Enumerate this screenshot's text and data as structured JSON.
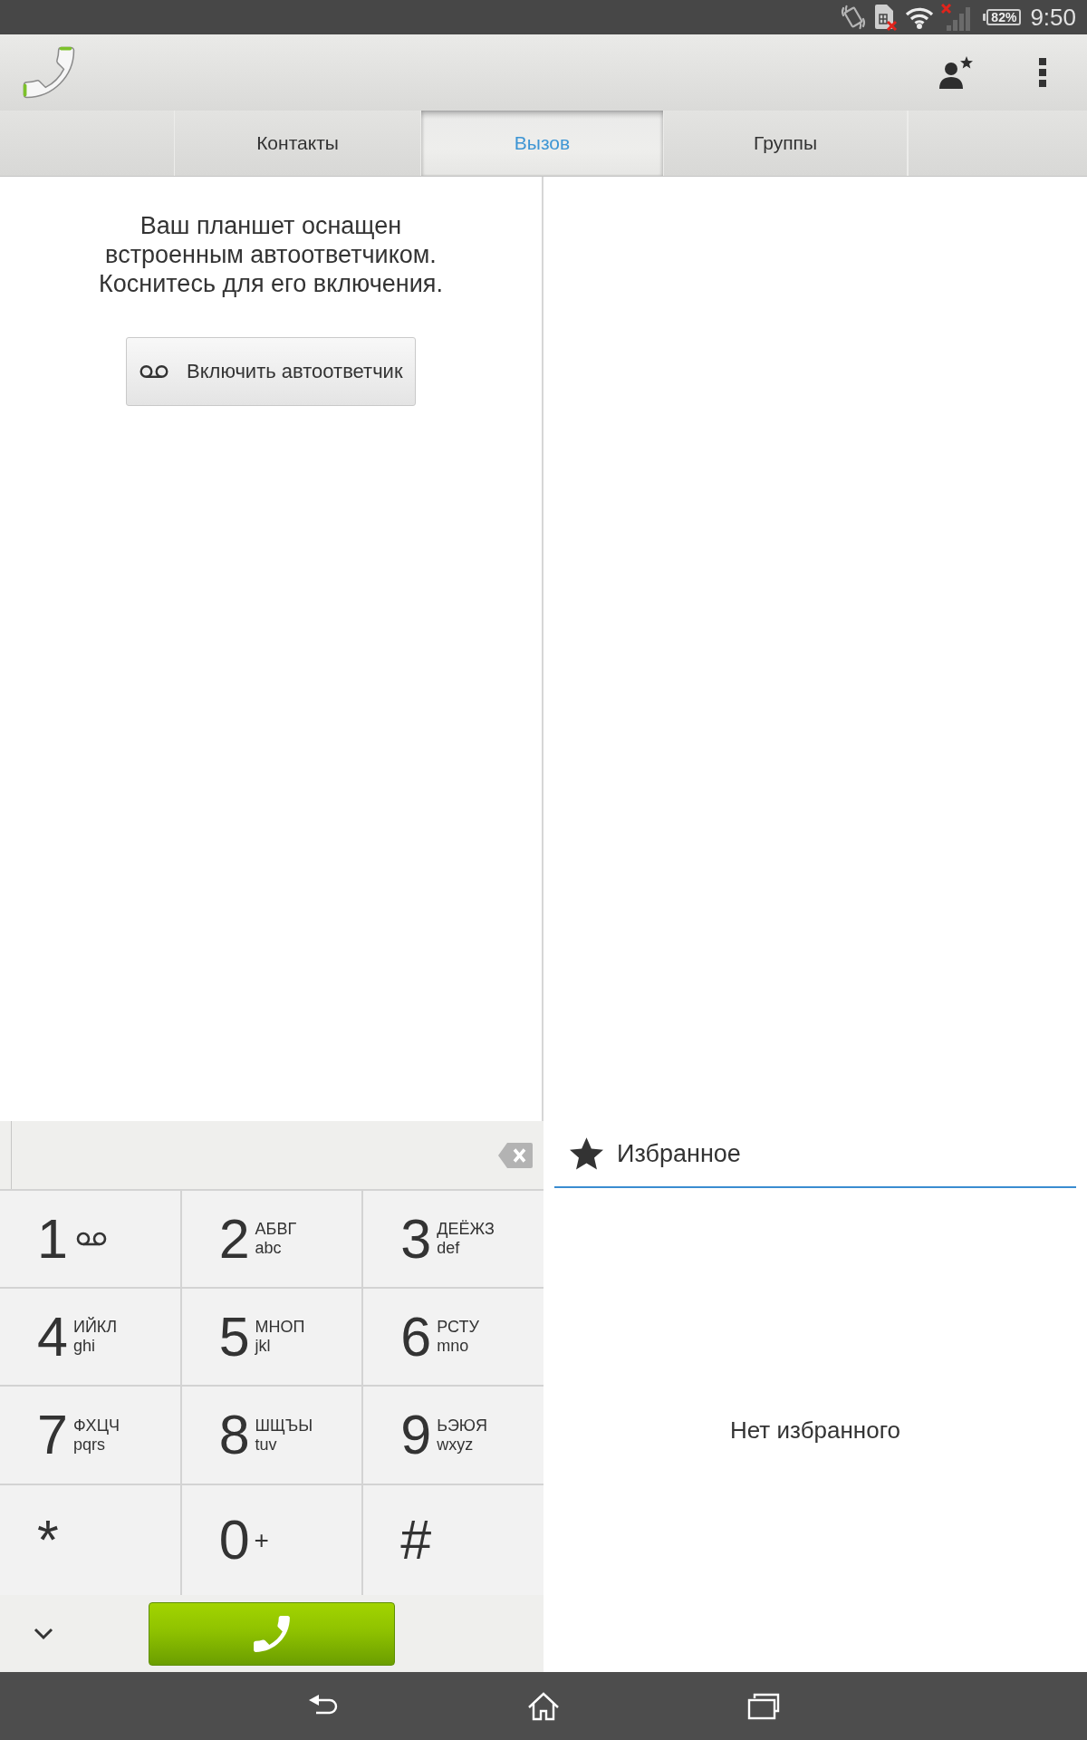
{
  "status_bar": {
    "battery": "82%",
    "time": "9:50"
  },
  "tabs": [
    {
      "label": "Контакты",
      "selected": false
    },
    {
      "label": "Вызов",
      "selected": true
    },
    {
      "label": "Группы",
      "selected": false
    }
  ],
  "voicemail_setup": {
    "message": "Ваш планшет оснащен\nвстроенным автоответчиком.\nКоснитесь для его включения.",
    "button": "Включить автоответчик"
  },
  "dialpad": {
    "keys": [
      {
        "kind": "voicemail",
        "digit": "1"
      },
      {
        "kind": "letters",
        "digit": "2",
        "letters": "АБВГ",
        "letters_latin": "abc"
      },
      {
        "kind": "letters",
        "digit": "3",
        "letters": "ДЕЁЖЗ",
        "letters_latin": "def"
      },
      {
        "kind": "letters",
        "digit": "4",
        "letters": "ИЙКЛ",
        "letters_latin": "ghi"
      },
      {
        "kind": "letters",
        "digit": "5",
        "letters": "МНОП",
        "letters_latin": "jkl"
      },
      {
        "kind": "letters",
        "digit": "6",
        "letters": "РСТУ",
        "letters_latin": "mno"
      },
      {
        "kind": "letters",
        "digit": "7",
        "letters": "ФХЦЧ",
        "letters_latin": "pqrs"
      },
      {
        "kind": "letters",
        "digit": "8",
        "letters": "ШЩЪЫ",
        "letters_latin": "tuv"
      },
      {
        "kind": "letters",
        "digit": "9",
        "letters": "ЬЭЮЯ",
        "letters_latin": "wxyz"
      },
      {
        "kind": "plain",
        "digit": "*"
      },
      {
        "kind": "plus",
        "digit": "0",
        "extra": "+"
      },
      {
        "kind": "plain",
        "digit": "#"
      }
    ]
  },
  "favorites": {
    "title": "Избранное",
    "empty_text": "Нет избранного"
  }
}
